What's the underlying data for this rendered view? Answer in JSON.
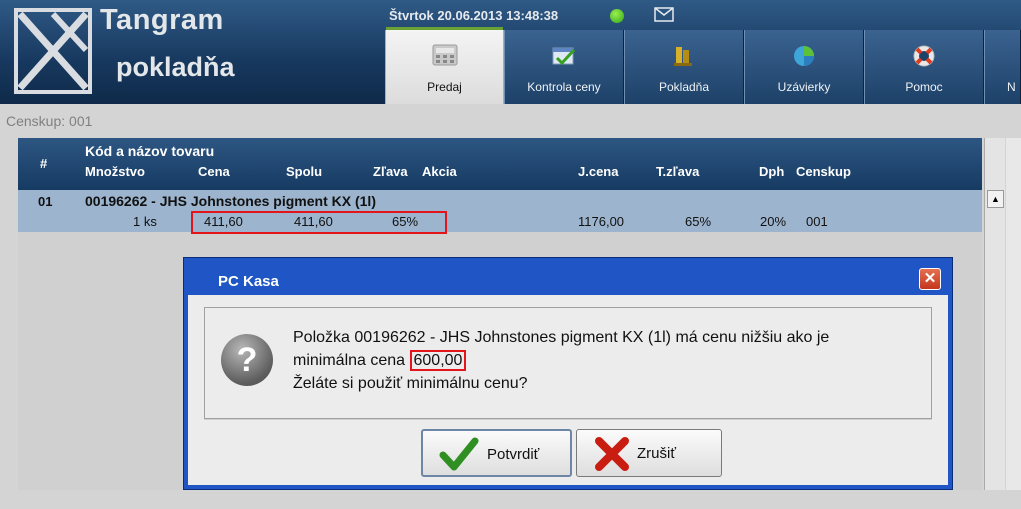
{
  "app": {
    "title": "Tangram",
    "subtitle": "pokladňa",
    "datetime": "Štvrtok 20.06.2013 13:48:38"
  },
  "tabs": [
    {
      "label": "Predaj",
      "icon": "calculator-icon",
      "active": true
    },
    {
      "label": "Kontrola ceny",
      "icon": "price-check-icon",
      "active": false
    },
    {
      "label": "Pokladňa",
      "icon": "cash-register-icon",
      "active": false
    },
    {
      "label": "Uzávierky",
      "icon": "pie-chart-icon",
      "active": false
    },
    {
      "label": "Pomoc",
      "icon": "lifebuoy-icon",
      "active": false
    },
    {
      "label": "N",
      "icon": "",
      "active": false
    }
  ],
  "censkup_label": "Censkup: 001",
  "grid": {
    "headers": {
      "num": "#",
      "name": "Kód a názov tovaru",
      "qty": "Množstvo",
      "price": "Cena",
      "total": "Spolu",
      "discount": "Zľava",
      "action": "Akcia",
      "unit_price": "J.cena",
      "t_discount": "T.zľava",
      "vat": "Dph",
      "censkup": "Censkup"
    },
    "rows": [
      {
        "num": "01",
        "name": "00196262 - JHS Johnstones pigment  KX  (1l)",
        "qty": "1 ks",
        "price": "411,60",
        "total": "411,60",
        "discount": "65%",
        "unit_price": "1176,00",
        "t_discount": "65%",
        "vat": "20%",
        "censkup": "001"
      }
    ]
  },
  "dialog": {
    "title": "PC Kasa",
    "message_line1": "Položka 00196262 - JHS Johnstones pigment  KX  (1l) má cenu nižšiu ako je",
    "message_line2_prefix": "minimálna cena ",
    "message_price": "600,00",
    "message_line3": "Želáte si použiť minimálnu cenu?",
    "confirm_label": "Potvrdiť",
    "cancel_label": "Zrušiť",
    "close_glyph": "✕",
    "question_glyph": "?"
  },
  "colors": {
    "header_blue": "#1d4168",
    "selected_row": "#9cb4cd",
    "dialog_blue": "#1f55c4",
    "highlight_red": "#e3141a",
    "status_green": "#2da41a"
  }
}
